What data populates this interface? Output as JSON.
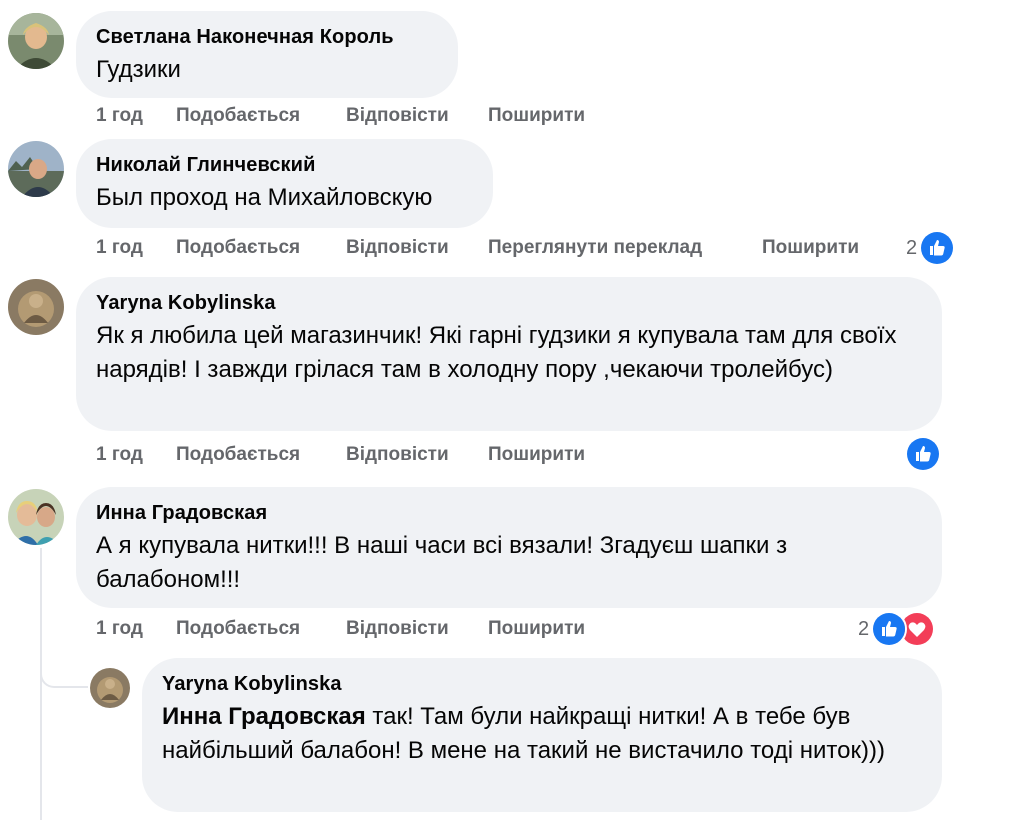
{
  "colors": {
    "bubble": "#f0f2f5",
    "action_text": "#65676b",
    "like_blue": "#1877f2",
    "love_red": "#f33e58",
    "thread_line": "#e4e6eb"
  },
  "comments": [
    {
      "author": "Светлана Наконечная Король",
      "text": "Гудзики",
      "time": "1 год",
      "like": "Подобається",
      "reply": "Відповісти",
      "share": "Поширити"
    },
    {
      "author": "Николай Глинчевский",
      "text": "Был проход на Михайловскую",
      "time": "1 год",
      "like": "Подобається",
      "reply": "Відповісти",
      "translate": "Переглянути переклад",
      "share": "Поширити",
      "reaction_count": "2",
      "reactions": [
        "like-icon"
      ]
    },
    {
      "author": "Yaryna Kobylinska",
      "text": "Як я любила цей магазинчик! Які гарні гудзики я купувала там для своїх нарядів! І завжди грілася там в холодну пору ,чекаючи тролейбус)",
      "time": "1 год",
      "like": "Подобається",
      "reply": "Відповісти",
      "share": "Поширити",
      "reactions": [
        "like-icon"
      ]
    },
    {
      "author": "Инна Градовская",
      "text": "А я купувала нитки!!! В наші часи всі вязали! Згадуєш шапки з балабоном!!!",
      "time": "1 год",
      "like": "Подобається",
      "reply": "Відповісти",
      "share": "Поширити",
      "reaction_count": "2",
      "reactions": [
        "like-icon",
        "love-icon"
      ]
    }
  ],
  "reply": {
    "author": "Yaryna Kobylinska",
    "mention": "Инна Градовская",
    "text": " так! Там були найкращі нитки! А в тебе був найбільший балабон! В мене на такий не вистачило тоді ниток)))"
  }
}
